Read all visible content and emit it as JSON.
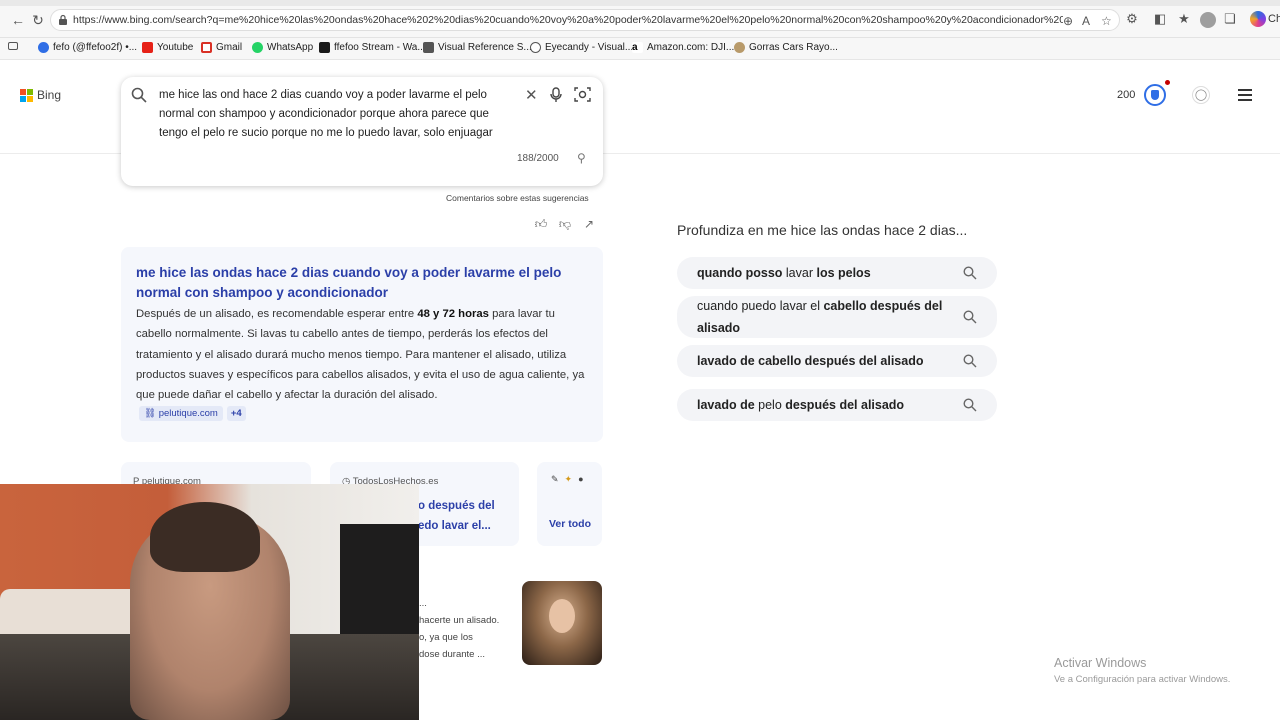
{
  "browser": {
    "url": "https://www.bing.com/search?q=me%20hice%20las%20ondas%20hace%202%20dias%20cuando%20voy%20a%20poder%20lavarme%20el%20pelo%20normal%20con%20shampoo%20y%20acondicionador%20porque%20ahora%20pa...",
    "copilot_label": "Ch",
    "bookmarks": [
      "fefo (@ffefoo2f) •...",
      "Youtube",
      "Gmail",
      "WhatsApp",
      "ffefoo Stream - Wa...",
      "Visual Reference S...",
      "Eyecandy - Visual...",
      "Amazon.com: DJI...",
      "Gorras Cars Rayo..."
    ]
  },
  "header": {
    "logo_text": "Bing",
    "rewards_count": "200"
  },
  "search": {
    "query_line1": "me hice las ond hace 2 dias cuando voy a poder lavarme el pelo",
    "query_line2": "normal con shampoo y acondicionador porque ahora parece que",
    "query_line3": "tengo el pelo re sucio porque no me lo puedo lavar, solo enjuagar",
    "char_count": "188/2000",
    "feedback": "Comentarios sobre estas sugerencias"
  },
  "answer": {
    "title": "me hice las ondas hace 2 dias cuando voy a poder lavarme el pelo normal con shampoo y acondicionador",
    "body_pre": "Después de un alisado, es recomendable esperar entre ",
    "body_bold": "48 y 72 horas",
    "body_post": " para lavar tu cabello normalmente. Si lavas tu cabello antes de tiempo, perderás los efectos del tratamiento y el alisado durará mucho menos tiempo. Para mantener el alisado, utiliza productos suaves y específicos para cabellos alisados, y evita el uso de agua caliente, ya que puede dañar el cabello y afectar la duración del alisado.",
    "source": "pelutique.com",
    "more": "+4"
  },
  "cards": [
    {
      "source": "pelutique.com",
      "title": ""
    },
    {
      "source": "TodosLosHechos.es",
      "title_line1": "o después del",
      "title_line2": "edo lavar el..."
    },
    {
      "see_all": "Ver todo"
    }
  ],
  "snippet": {
    "line1": "...",
    "line2": "hacerte un alisado.",
    "line3": "o, ya que los",
    "line4": "dose durante ..."
  },
  "related": {
    "title": "Profundiza en me hice las ondas hace 2 dias...",
    "items": [
      {
        "b1": "quando posso",
        "n1": " lavar ",
        "b2": "los pelos",
        "n2": ""
      },
      {
        "n1": "cuando puedo lavar el ",
        "b1": "cabello después",
        "n2": " ",
        "b2": "del alisado"
      },
      {
        "b1": "lavado de cabello después del alisado"
      },
      {
        "b1": "lavado de",
        "n1": " pelo ",
        "b2": "después del alisado"
      }
    ]
  },
  "watermark": {
    "line1": "Activar Windows",
    "line2": "Ve a Configuración para activar Windows."
  }
}
